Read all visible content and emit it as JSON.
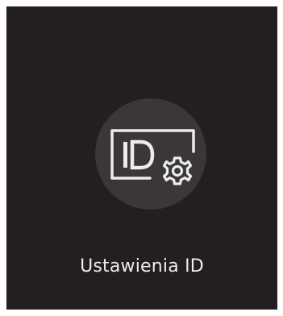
{
  "app": {
    "item_label": "Ustawienia ID",
    "icon": "id-settings-icon"
  },
  "colors": {
    "background": "#231f20",
    "circle": "#3b3738",
    "foreground": "#ececec"
  }
}
